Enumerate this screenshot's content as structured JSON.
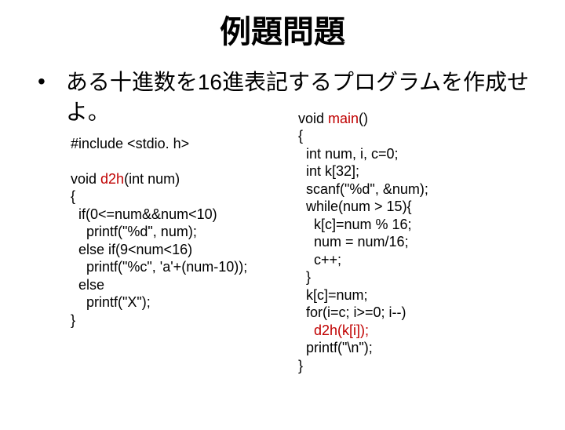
{
  "title": "例題問題",
  "bullet": "ある十進数を16進表記するプログラムを作成せよ。",
  "colors": {
    "fn": "#c00000"
  },
  "code_left": {
    "l1": "#include <stdio. h>",
    "l2": "",
    "l3a": "void ",
    "l3b": "d2h",
    "l3c": "(int num)",
    "l4": "{",
    "l5": "  if(0<=num&&num<10)",
    "l6": "    printf(\"%d\", num);",
    "l7": "  else if(9<num<16)",
    "l8": "    printf(\"%c\", 'a'+(num-10));",
    "l9": "  else",
    "l10": "    printf(\"X\");",
    "l11": "}"
  },
  "code_right": {
    "r1a": "void ",
    "r1b": "main",
    "r1c": "()",
    "r2": "{",
    "r3": "  int num, i, c=0;",
    "r4": "  int k[32];",
    "r5": "  scanf(\"%d\", &num);",
    "r6": "  while(num > 15){",
    "r7": "    k[c]=num % 16;",
    "r8": "    num = num/16;",
    "r9": "    c++;",
    "r10": "  }",
    "r11": "  k[c]=num;",
    "r12": "  for(i=c; i>=0; i--)",
    "r13a": "    ",
    "r13b": "d2h(k[i]);",
    "r14": "  printf(\"\\n\");",
    "r15": "}"
  }
}
